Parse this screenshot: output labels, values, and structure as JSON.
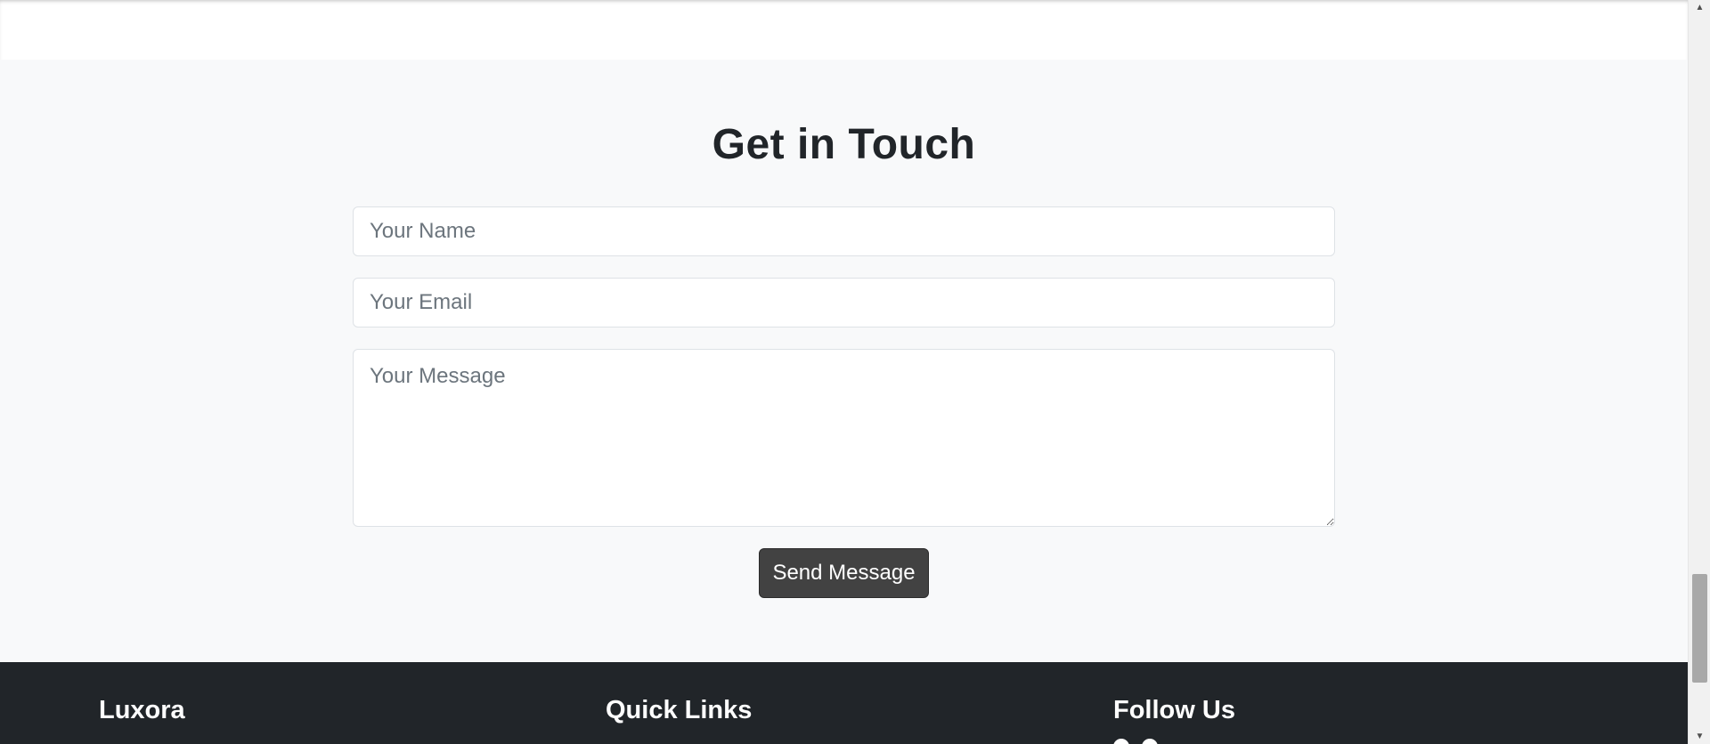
{
  "contact": {
    "title": "Get in Touch",
    "name_placeholder": "Your Name",
    "email_placeholder": "Your Email",
    "message_placeholder": "Your Message",
    "send_label": "Send Message"
  },
  "footer": {
    "brand": "Luxora",
    "quick_links_heading": "Quick Links",
    "follow_heading": "Follow Us"
  },
  "colors": {
    "section_bg": "#f8f9fa",
    "button_bg": "#424242",
    "footer_bg": "#212529"
  },
  "scrollbar": {
    "up_icon": "▲",
    "down_icon": "▼"
  }
}
